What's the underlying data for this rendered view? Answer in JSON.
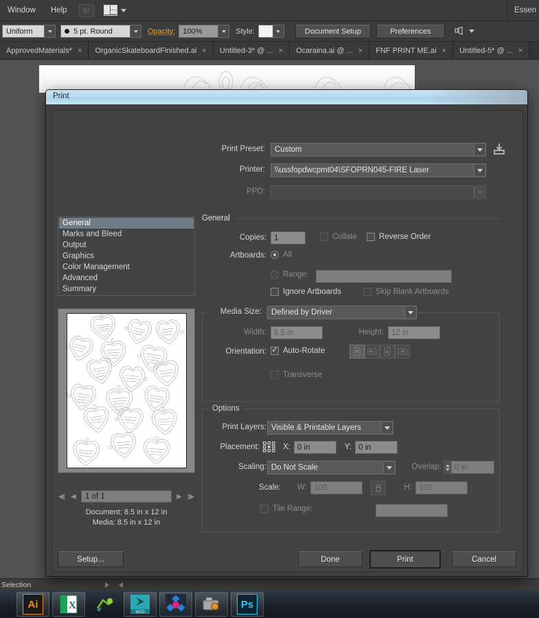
{
  "app": {
    "menus": [
      "Window",
      "Help"
    ],
    "bridge_label": "Br",
    "workspace_label": "Essen",
    "options_bar": {
      "profile_value": "Uniform",
      "brush_value": "5 pt. Round",
      "opacity_label": "Opacity:",
      "opacity_value": "100%",
      "style_label": "Style:",
      "document_setup_label": "Document Setup",
      "preferences_label": "Preferences"
    },
    "tabs": [
      "ApprovedMaterials*",
      "OrganicSkateboardFinished.ai",
      "Untitled-3* @ ...",
      "Ocaraina.ai @ ...",
      "FNF PRINT ME.ai",
      "Untitled-5* @ ..."
    ],
    "tab_close_glyph": "×",
    "status_bar": {
      "text": "Selection"
    }
  },
  "dialog": {
    "title": "Print",
    "print_preset": {
      "label": "Print Preset:",
      "value": "Custom"
    },
    "printer": {
      "label": "Printer:",
      "value": "\\\\ussfopdwcpmt04\\SFOPRN045-FIRE Laser"
    },
    "ppd": {
      "label": "PPD:",
      "value": ""
    },
    "save_preset_icon": "save-preset-icon",
    "nav_items": [
      "General",
      "Marks and Bleed",
      "Output",
      "Graphics",
      "Color Management",
      "Advanced",
      "Summary"
    ],
    "nav_selected": "General",
    "section_title": "General",
    "general": {
      "copies_label": "Copies:",
      "copies_value": "1",
      "collate_label": "Collate",
      "collate_checked": false,
      "reverse_order_label": "Reverse Order",
      "reverse_order_checked": false,
      "artboards_label": "Artboards:",
      "all_label": "All",
      "all_selected": true,
      "range_label": "Range:",
      "range_value": "",
      "ignore_artboards_label": "Ignore Artboards",
      "ignore_artboards_checked": false,
      "skip_blank_label": "Skip Blank Artboards",
      "skip_blank_checked": false
    },
    "media_size": {
      "group_label": "Media Size:",
      "value": "Defined by Driver",
      "width_label": "Width:",
      "width_value": "8.5 in",
      "height_label": "Height:",
      "height_value": "12 in",
      "orientation_label": "Orientation:",
      "auto_rotate_label": "Auto-Rotate",
      "auto_rotate_checked": true,
      "orientation_buttons": [
        "portrait-up-icon",
        "landscape-left-icon",
        "portrait-down-icon",
        "landscape-right-icon"
      ],
      "orientation_selected": 0,
      "transverse_label": "Transverse",
      "transverse_checked": false
    },
    "options": {
      "group_label": "Options",
      "print_layers_label": "Print Layers:",
      "print_layers_value": "Visible & Printable Layers",
      "placement_label": "Placement:",
      "placement_icon": "placement-grid-icon",
      "x_label": "X:",
      "x_value": "0 in",
      "y_label": "Y:",
      "y_value": "0 in",
      "scaling_label": "Scaling:",
      "scaling_value": "Do Not Scale",
      "overlap_label": "Overlap:",
      "overlap_value": "0 in",
      "scale_label": "Scale:",
      "scale_w_label": "W:",
      "scale_w_value": "100",
      "link_icon": "link-constrain-icon",
      "scale_h_label": "H:",
      "scale_h_value": "100",
      "tile_range_label": "Tile Range:",
      "tile_range_value": "",
      "tile_range_checked": false
    },
    "preview": {
      "page_indicator": "1 of 1",
      "document_info": "Document: 8.5 in x 12 in",
      "media_info": "Media: 8.5 in x 12 in",
      "first_icon": "first-page-icon",
      "prev_icon": "previous-page-icon",
      "next_icon": "next-page-icon",
      "last_icon": "last-page-icon"
    },
    "buttons": {
      "setup": "Setup...",
      "done": "Done",
      "print": "Print",
      "cancel": "Cancel"
    }
  },
  "taskbar": {
    "items": [
      {
        "name": "illustrator",
        "label": "Ai"
      },
      {
        "name": "excel",
        "label": "X"
      },
      {
        "name": "grasshopper-app",
        "label": ""
      },
      {
        "name": "arcmap-mxd",
        "label": "MXD"
      },
      {
        "name": "diagram-app",
        "label": ""
      },
      {
        "name": "camera-app",
        "label": ""
      },
      {
        "name": "photoshop",
        "label": "Ps"
      }
    ]
  },
  "colors": {
    "accent_amber": "#e8a33d",
    "title_blue": "#bcdcf2",
    "nav_selected": "#6f7b85",
    "dialog_bg": "#434343"
  }
}
